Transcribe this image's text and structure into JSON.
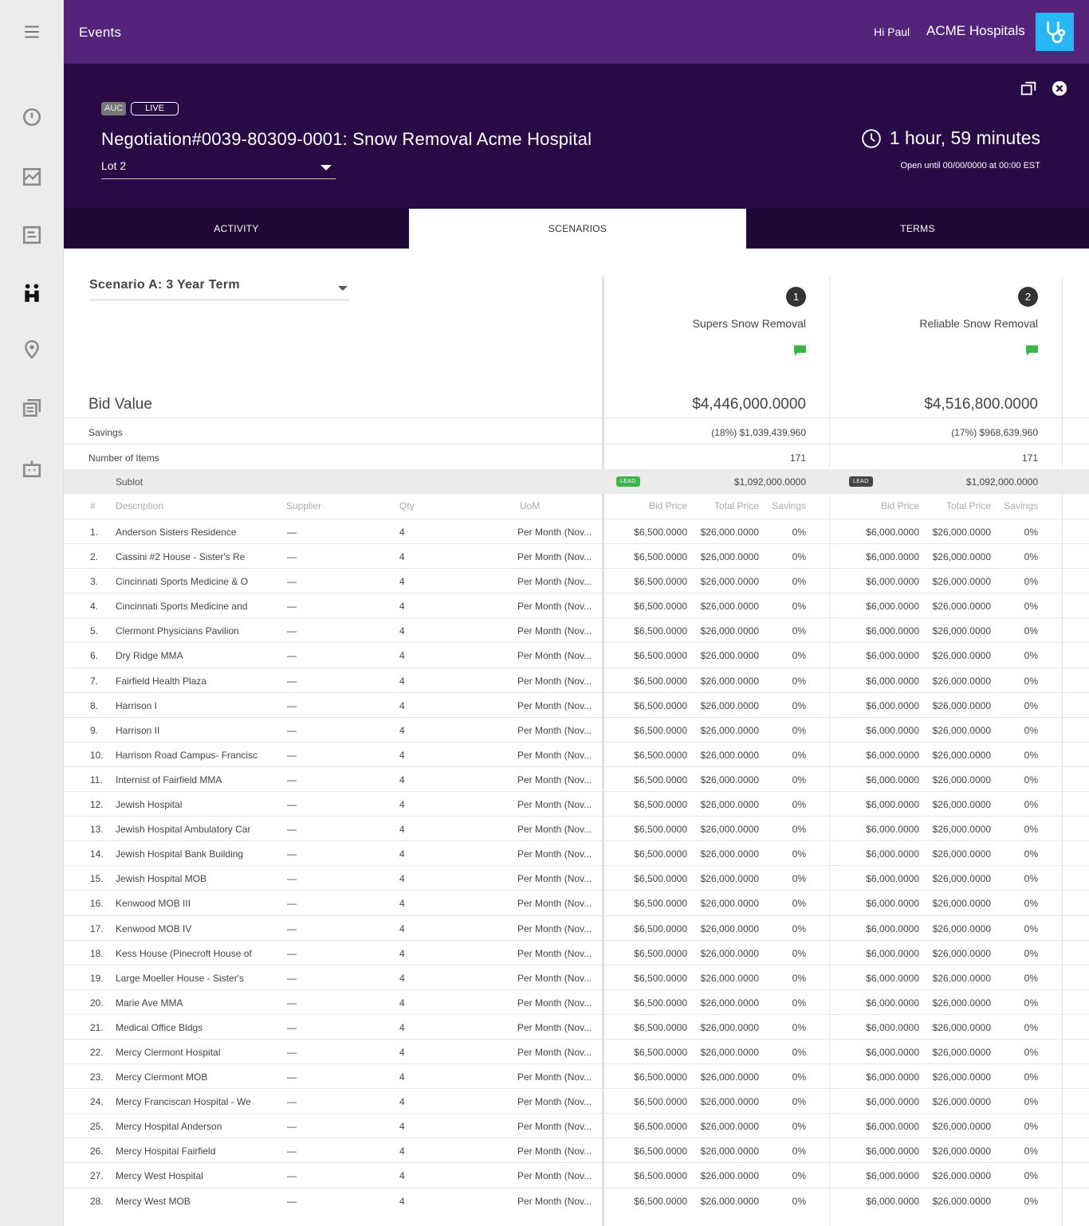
{
  "topbar": {
    "title": "Events",
    "greeting": "Hi Paul",
    "org": "ACME Hospitals"
  },
  "header": {
    "badge_auc": "AUC",
    "badge_live": "LIVE",
    "title": "Negotiation#0039-80309-0001: Snow Removal Acme Hospital",
    "lot": "Lot 2",
    "timer": "1 hour, 59 minutes",
    "open_until": "Open until 00/00/0000 at 00:00 EST"
  },
  "tabs": [
    "ACTIVITY",
    "SCENARIOS",
    "TERMS"
  ],
  "scenario": {
    "selected": "Scenario A: 3 Year Term",
    "bid_value_label": "Bid Value",
    "savings_label": "Savings",
    "items_label": "Number of Items",
    "sublot_label": "Sublot"
  },
  "suppliers": [
    {
      "rank": "1",
      "name": "Supers Snow Removal",
      "bid_value": "$4,446,000.0000",
      "savings": "(18%) $1,039,439.960",
      "items": "171",
      "lead": "LEAD",
      "sublot_total": "$1,092,000.0000",
      "lead_color": "#3bb54a"
    },
    {
      "rank": "2",
      "name": "Reliable Snow Removal",
      "bid_value": "$4,516,800.0000",
      "savings": "(17%) $968,639.960",
      "items": "171",
      "lead": "LEAD",
      "sublot_total": "$1,092,000.0000",
      "lead_color": "#444444"
    }
  ],
  "columns": {
    "num": "#",
    "description": "Description",
    "supplier": "Supplier",
    "qty": "Qty",
    "uom": "UoM",
    "bid_price": "Bid Price",
    "total_price": "Total Price",
    "savings": "Savings"
  },
  "rows": [
    {
      "n": "1.",
      "desc": "Anderson Sisters Residence"
    },
    {
      "n": "2.",
      "desc": "Cassini #2 House - Sister's Re"
    },
    {
      "n": "3.",
      "desc": "Cincinnati Sports Medicine & O"
    },
    {
      "n": "4.",
      "desc": "Cincinnati Sports Medicine and"
    },
    {
      "n": "5.",
      "desc": "Clermont Physicians Pavilion"
    },
    {
      "n": "6.",
      "desc": "Dry Ridge MMA"
    },
    {
      "n": "7.",
      "desc": "Fairfield Health Plaza"
    },
    {
      "n": "8.",
      "desc": "Harrison I"
    },
    {
      "n": "9.",
      "desc": "Harrison II"
    },
    {
      "n": "10.",
      "desc": "Harrison Road Campus- Francisc"
    },
    {
      "n": "11.",
      "desc": "Internist of Fairfield MMA"
    },
    {
      "n": "12.",
      "desc": "Jewish Hospital"
    },
    {
      "n": "13.",
      "desc": "Jewish Hospital Ambulatory Car"
    },
    {
      "n": "14.",
      "desc": "Jewish Hospital Bank Building"
    },
    {
      "n": "15.",
      "desc": "Jewish Hospital MOB"
    },
    {
      "n": "16.",
      "desc": "Kenwood MOB III"
    },
    {
      "n": "17.",
      "desc": "Kenwood MOB IV"
    },
    {
      "n": "18.",
      "desc": "Kess House (Pinecroft House of"
    },
    {
      "n": "19.",
      "desc": "Large Moeller House - Sister's"
    },
    {
      "n": "20.",
      "desc": "Marie Ave MMA"
    },
    {
      "n": "21.",
      "desc": "Medical Office Bldgs"
    },
    {
      "n": "22.",
      "desc": "Mercy Clermont Hospital"
    },
    {
      "n": "23.",
      "desc": "Mercy Clermont MOB"
    },
    {
      "n": "24.",
      "desc": "Mercy Franciscan Hospital - We"
    },
    {
      "n": "25.",
      "desc": "Mercy Hospital Anderson"
    },
    {
      "n": "26.",
      "desc": "Mercy Hospital Fairfield"
    },
    {
      "n": "27.",
      "desc": "Mercy West Hospital"
    },
    {
      "n": "28.",
      "desc": "Mercy West MOB"
    }
  ],
  "row_defaults": {
    "supplier": "—",
    "qty": "4",
    "uom": "Per Month (Nov...",
    "s1_bid": "$6,500.0000",
    "s1_total": "$26,000.0000",
    "s1_savings": "0%",
    "s2_bid": "$6,000.0000",
    "s2_total": "$26,000.0000",
    "s2_savings": "0%"
  },
  "icons": {
    "menu": "hamburger-menu-icon",
    "logo": "stethoscope-icon",
    "popout": "popout-window-icon",
    "close": "close-circle-icon",
    "clock": "clock-icon",
    "chat": "chat-bubble-icon"
  },
  "colors": {
    "topbar": "#532479",
    "header": "#2a0a45",
    "tabs": "#1f0836",
    "logo_bg": "#29b6f6",
    "chat": "#3bb54a"
  }
}
